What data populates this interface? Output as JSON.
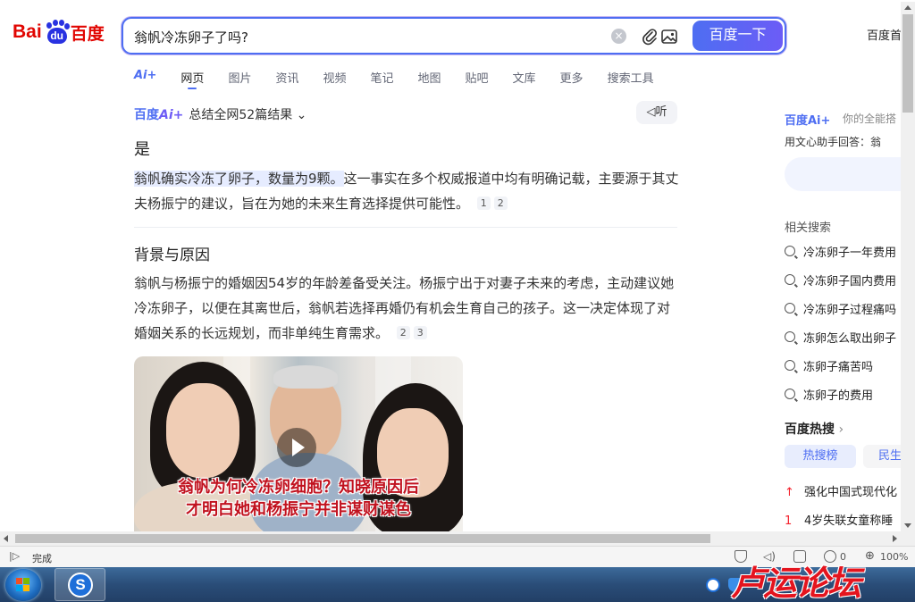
{
  "header": {
    "logo_bai": "Bai",
    "logo_du": "du",
    "logo_cn": "百度",
    "search_value": "翁帆冷冻卵子了吗?",
    "clear_icon": "×",
    "search_button": "百度一下",
    "home_link": "百度首"
  },
  "tabs": [
    {
      "label": "Ai+"
    },
    {
      "label": "网页"
    },
    {
      "label": "图片"
    },
    {
      "label": "资讯"
    },
    {
      "label": "视频"
    },
    {
      "label": "笔记"
    },
    {
      "label": "地图"
    },
    {
      "label": "贴吧"
    },
    {
      "label": "文库"
    },
    {
      "label": "更多"
    },
    {
      "label": "搜索工具"
    }
  ],
  "ai_answer": {
    "brand": "百度",
    "brand_ai": "Ai+",
    "summary": "总结全网52篇结果",
    "listen": "听",
    "title": "是",
    "para1_highlight": "翁帆确实冷冻了卵子，数量为9颗。",
    "para1_rest": "这一事实在多个权威报道中均有明确记载，主要源于其丈夫杨振宁的建议，旨在为她的未来生育选择提供可能性。",
    "para1_refs": [
      "1",
      "2"
    ],
    "section_title": "背景与原因",
    "para2": "翁帆与杨振宁的婚姻因54岁的年龄差备受关注。杨振宁出于对妻子未来的考虑，主动建议她冷冻卵子，以便在其离世后，翁帆若选择再婚仍有机会生育自己的孩子。这一决定体现了对婚姻关系的长远规划，而非单纯生育需求。",
    "para2_refs": [
      "2",
      "3"
    ],
    "video_caption_1": "翁帆为何冷冻卵细胞？知晓原因后",
    "video_caption_2": "才明白她和杨振宁并非谋财谋色"
  },
  "sidebar": {
    "ai_brand": "百度Ai+",
    "ai_sub": "你的全能搭",
    "ai_answer": "用文心助手回答：翁",
    "related_title": "相关搜索",
    "related": [
      "冷冻卵子一年费用",
      "冷冻卵子国内费用",
      "冷冻卵子过程痛吗",
      "冻卵怎么取出卵子",
      "冻卵子痛苦吗",
      "冻卵子的费用"
    ],
    "hot_title": "百度热搜",
    "hot_tabs": [
      "热搜榜",
      "民生"
    ],
    "hot_items": [
      {
        "rank": "↑",
        "text": "强化中国式现代化"
      },
      {
        "rank": "1",
        "text": "4岁失联女童称睡"
      }
    ]
  },
  "statusbar": {
    "status": "完成",
    "ad_count": "0",
    "zoom": "100%"
  },
  "watermark": "卢运论坛",
  "colors": {
    "brand_blue": "#4e6ef2",
    "brand_red": "#e10602",
    "hot_red": "#f5222d"
  }
}
